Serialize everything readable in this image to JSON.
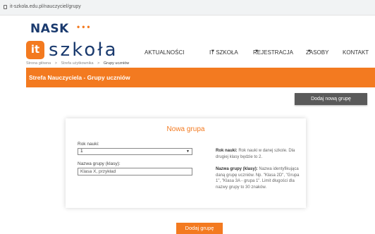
{
  "browser": {
    "url": "it-szkola.edu.pl/nauczyciel/grupy"
  },
  "logo": {
    "nask": "NASK",
    "dots": "•••",
    "it": "it",
    "word": "szkoła"
  },
  "nav": {
    "items": [
      {
        "label": "AKTUALNOŚCI"
      },
      {
        "label": "IT SZKOŁA"
      },
      {
        "label": "REJESTRACJA"
      },
      {
        "label": "ZASOBY"
      },
      {
        "label": "KONTAKT"
      }
    ],
    "caret": "▼"
  },
  "breadcrumb": {
    "items": [
      "Strona główna",
      "Strefa użytkownika",
      "Grupy uczniów"
    ],
    "separator": ">"
  },
  "banner": {
    "title": "Strefa Nauczyciela - Grupy uczniów"
  },
  "actions": {
    "add_group_top": "Dodaj nową grupę"
  },
  "form": {
    "title": "Nowa grupa",
    "year_label": "Rok nauki:",
    "year_value": "1",
    "group_name_label": "Nazwa grupy (klasy):",
    "group_name_value": "Klasa X, przykład",
    "help_year_title": "Rok nauki:",
    "help_year_text": "Rok nauki w danej szkole. Dla drugiej klasy będzie to 2.",
    "help_name_title": "Nazwa grupy (klasy):",
    "help_name_text": "Nazwa identyfikująca daną grupę uczniów. Np. \"Klasa 2D\", \"Grupa 1\", \"Klasa 3A - grupa 1\". Limit długości dla nazwy grupy to 30 znaków.",
    "submit": "Dodaj grupę"
  },
  "colors": {
    "accent": "#f37a20",
    "navy": "#1a3a6e",
    "dark_button": "#5a5a5a"
  }
}
